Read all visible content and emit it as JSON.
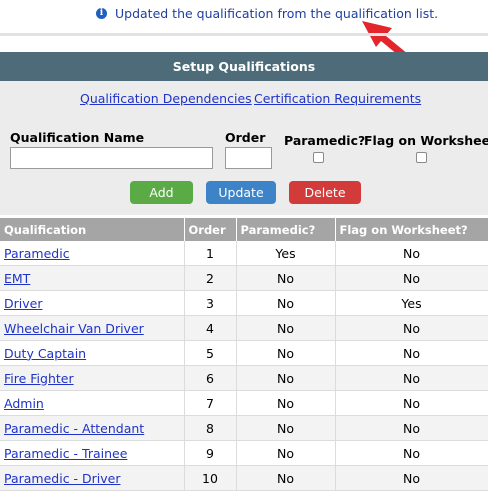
{
  "notice": {
    "text": "Updated the qualification from the qualification list.",
    "icon": "info-icon"
  },
  "header": {
    "title": "Setup Qualifications"
  },
  "links": {
    "dependencies": "Qualification Dependencies",
    "certification": "Certification Requirements"
  },
  "form": {
    "name_label": "Qualification Name",
    "order_label": "Order",
    "paramedic_label": "Paramedic?",
    "flag_label": "Flag on Worksheet?",
    "name_value": "",
    "order_value": ""
  },
  "buttons": {
    "add": "Add",
    "update": "Update",
    "delete": "Delete"
  },
  "table": {
    "headers": [
      "Qualification",
      "Order",
      "Paramedic?",
      "Flag on Worksheet?"
    ],
    "rows": [
      [
        "Paramedic",
        "1",
        "Yes",
        "No"
      ],
      [
        "EMT",
        "2",
        "No",
        "No"
      ],
      [
        "Driver",
        "3",
        "No",
        "Yes"
      ],
      [
        "Wheelchair Van Driver",
        "4",
        "No",
        "No"
      ],
      [
        "Duty Captain",
        "5",
        "No",
        "No"
      ],
      [
        "Fire Fighter",
        "6",
        "No",
        "No"
      ],
      [
        "Admin",
        "7",
        "No",
        "No"
      ],
      [
        "Paramedic - Attendant",
        "8",
        "No",
        "No"
      ],
      [
        "Paramedic - Trainee",
        "9",
        "No",
        "No"
      ],
      [
        "Paramedic - Driver",
        "10",
        "No",
        "No"
      ]
    ]
  },
  "colors": {
    "header_bg": "#4d6b78",
    "add": "#5aaa45",
    "update": "#3c83c8",
    "delete": "#d33b3b",
    "arrow": "#e3262b"
  }
}
